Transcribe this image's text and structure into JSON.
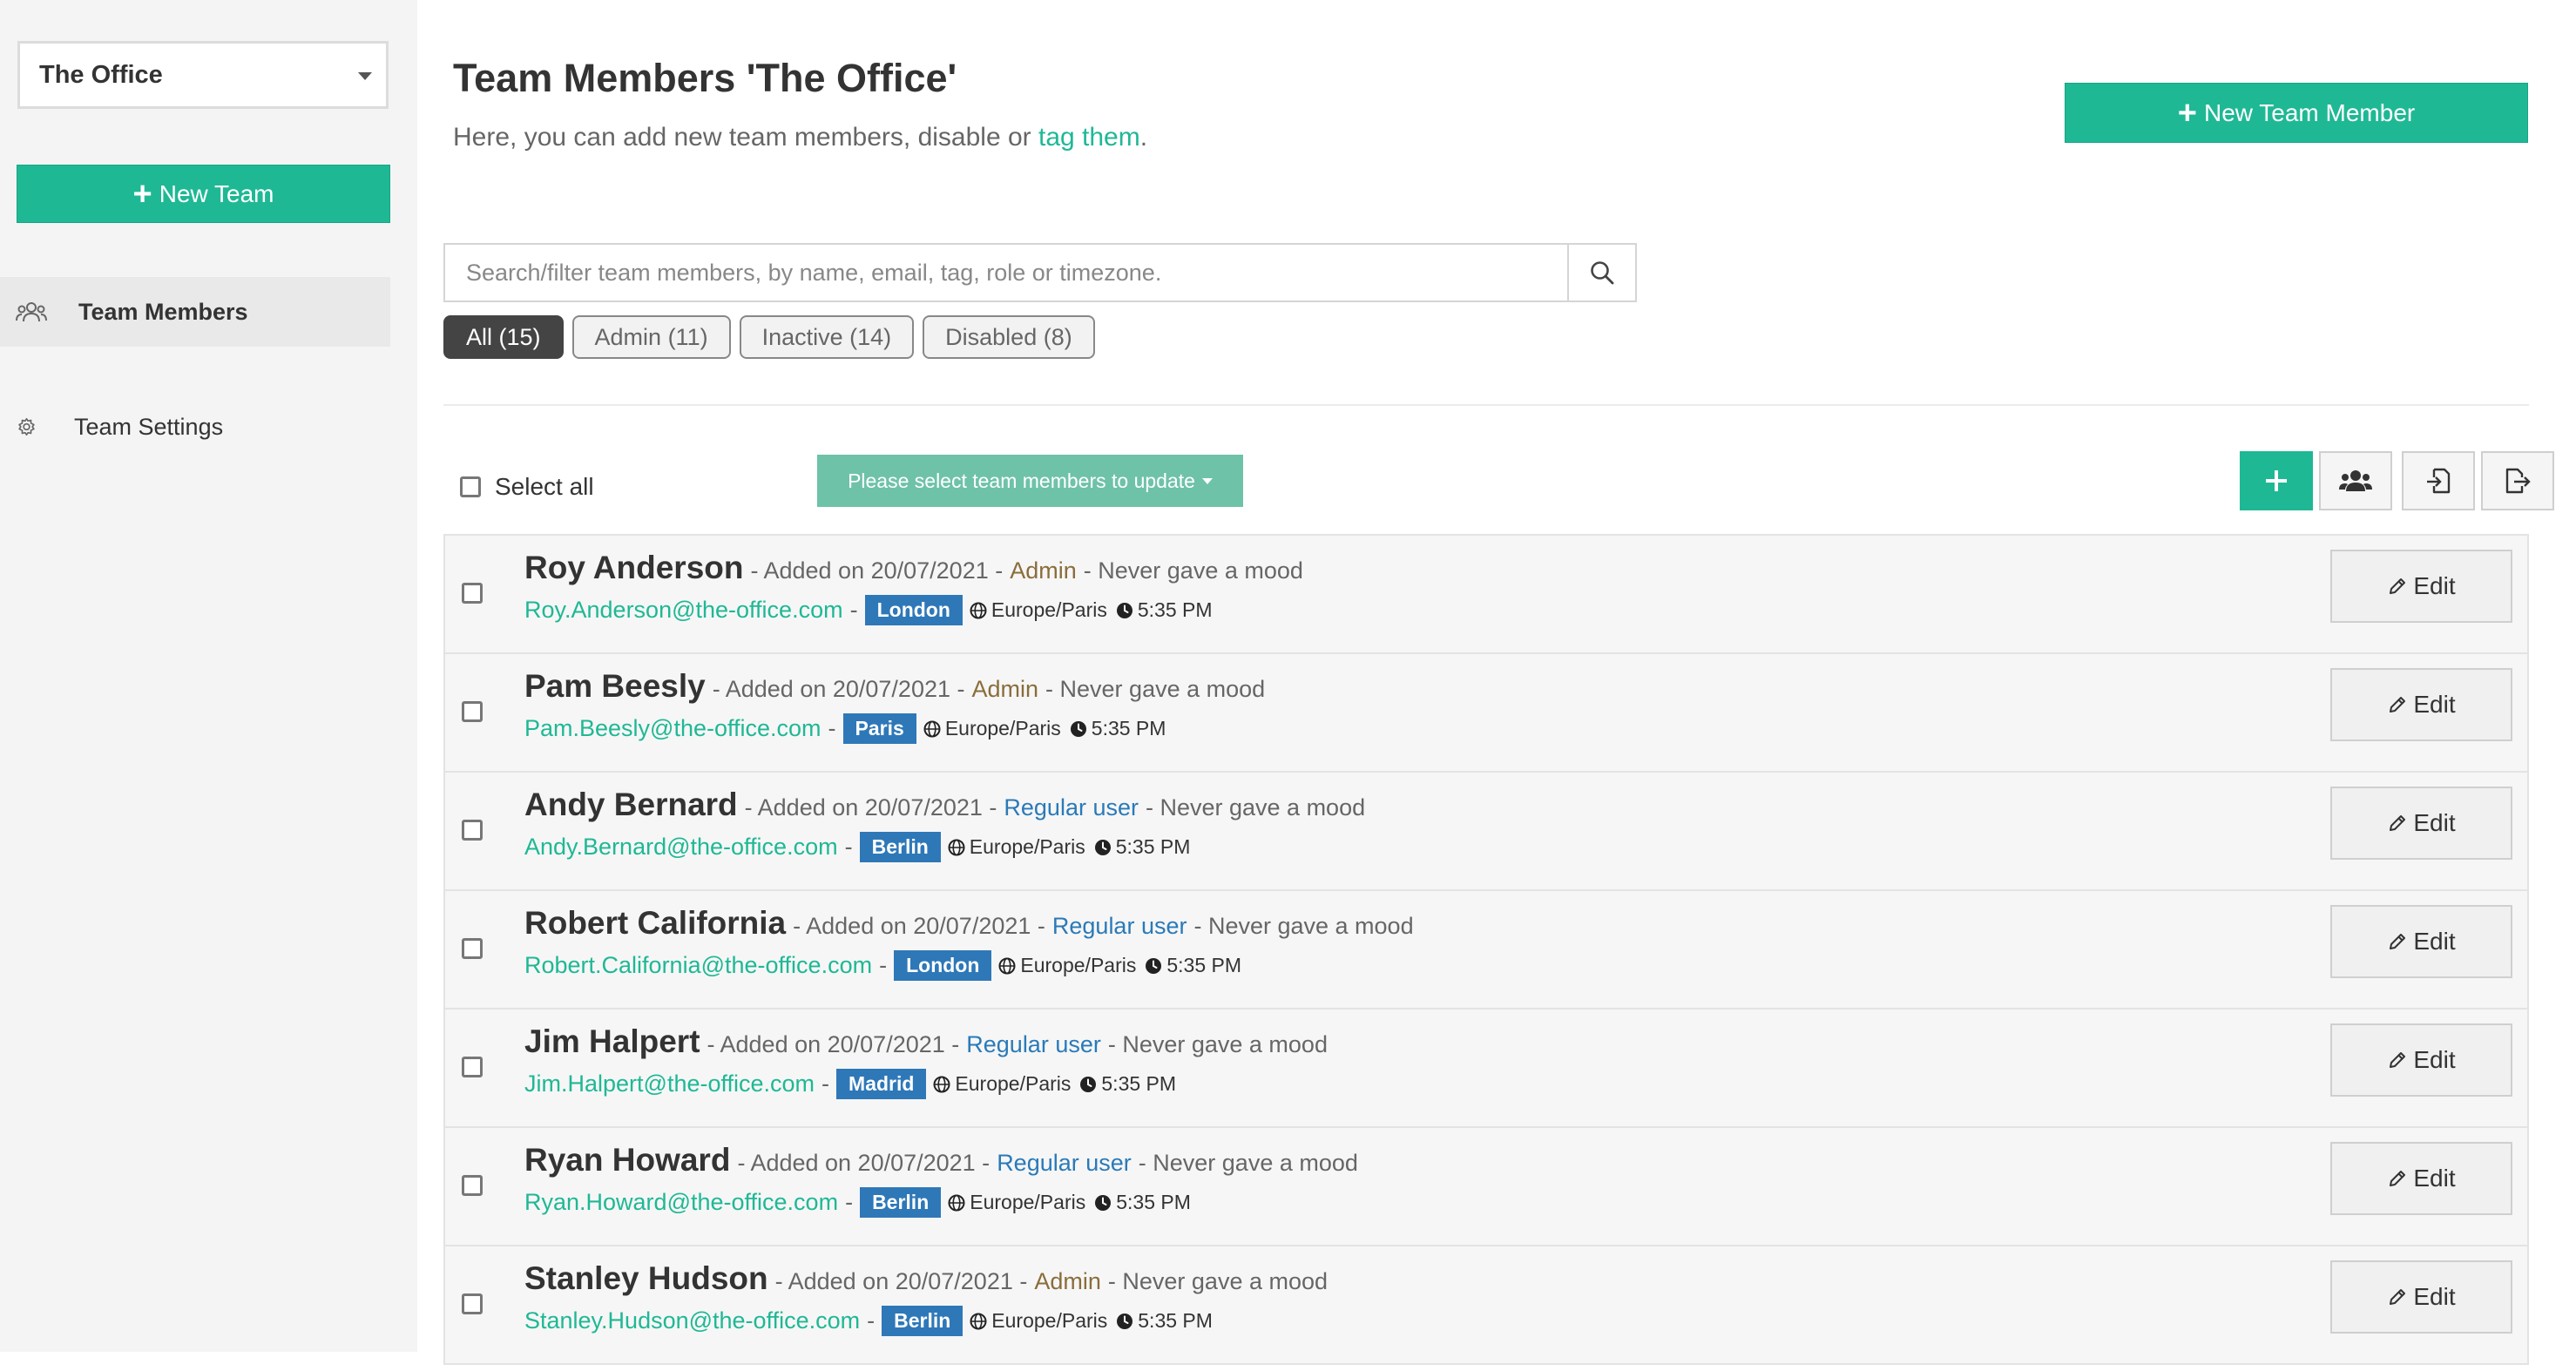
{
  "sidebar": {
    "team_select_value": "The Office",
    "new_team_label": "New Team",
    "nav": [
      {
        "label": "Team Members",
        "icon": "users-icon",
        "active": true
      },
      {
        "label": "Team Settings",
        "icon": "gear-icon",
        "active": false
      }
    ]
  },
  "header": {
    "title": "Team Members 'The Office'",
    "subtitle_prefix": "Here, you can add new team members, disable or ",
    "subtitle_link": "tag them",
    "subtitle_suffix": ".",
    "new_member_label": "New Team Member"
  },
  "search": {
    "placeholder": "Search/filter team members, by name, email, tag, role or timezone.",
    "value": ""
  },
  "filters": [
    {
      "label": "All (15)",
      "active": true
    },
    {
      "label": "Admin (11)",
      "active": false
    },
    {
      "label": "Inactive (14)",
      "active": false
    },
    {
      "label": "Disabled (8)",
      "active": false
    }
  ],
  "toolbar": {
    "select_all_label": "Select all",
    "bulk_update_label": "Please select team members to update"
  },
  "members": [
    {
      "name": "Roy Anderson",
      "added": "- Added on 20/07/2021 -",
      "role": "Admin",
      "role_type": "admin",
      "mood": "- Never gave a mood",
      "email": "Roy.Anderson@the-office.com",
      "sep": "-",
      "city": "London",
      "timezone": "Europe/Paris",
      "time": "5:35 PM",
      "edit_label": "Edit"
    },
    {
      "name": "Pam Beesly",
      "added": "- Added on 20/07/2021 -",
      "role": "Admin",
      "role_type": "admin",
      "mood": "- Never gave a mood",
      "email": "Pam.Beesly@the-office.com",
      "sep": "-",
      "city": "Paris",
      "timezone": "Europe/Paris",
      "time": "5:35 PM",
      "edit_label": "Edit"
    },
    {
      "name": "Andy Bernard",
      "added": "- Added on 20/07/2021 -",
      "role": "Regular user",
      "role_type": "regular",
      "mood": "- Never gave a mood",
      "email": "Andy.Bernard@the-office.com",
      "sep": "-",
      "city": "Berlin",
      "timezone": "Europe/Paris",
      "time": "5:35 PM",
      "edit_label": "Edit"
    },
    {
      "name": "Robert California",
      "added": "- Added on 20/07/2021 -",
      "role": "Regular user",
      "role_type": "regular",
      "mood": "- Never gave a mood",
      "email": "Robert.California@the-office.com",
      "sep": "-",
      "city": "London",
      "timezone": "Europe/Paris",
      "time": "5:35 PM",
      "edit_label": "Edit"
    },
    {
      "name": "Jim Halpert",
      "added": "- Added on 20/07/2021 -",
      "role": "Regular user",
      "role_type": "regular",
      "mood": "- Never gave a mood",
      "email": "Jim.Halpert@the-office.com",
      "sep": "-",
      "city": "Madrid",
      "timezone": "Europe/Paris",
      "time": "5:35 PM",
      "edit_label": "Edit"
    },
    {
      "name": "Ryan Howard",
      "added": "- Added on 20/07/2021 -",
      "role": "Regular user",
      "role_type": "regular",
      "mood": "- Never gave a mood",
      "email": "Ryan.Howard@the-office.com",
      "sep": "-",
      "city": "Berlin",
      "timezone": "Europe/Paris",
      "time": "5:35 PM",
      "edit_label": "Edit"
    },
    {
      "name": "Stanley Hudson",
      "added": "- Added on 20/07/2021 -",
      "role": "Admin",
      "role_type": "admin",
      "mood": "- Never gave a mood",
      "email": "Stanley.Hudson@the-office.com",
      "sep": "-",
      "city": "Berlin",
      "timezone": "Europe/Paris",
      "time": "5:35 PM",
      "edit_label": "Edit"
    }
  ],
  "colors": {
    "accent": "#1fb895",
    "badge_blue": "#2e78b8",
    "admin_role": "#8a6d3b",
    "regular_role": "#2a7ab8"
  }
}
